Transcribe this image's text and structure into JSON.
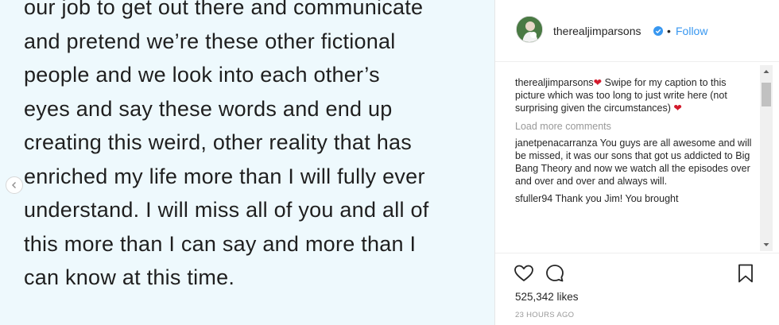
{
  "post": {
    "lines": [
      "our job to get out there and communicate",
      "and pretend we’re these other fictional",
      "people and we look into each other’s",
      "eyes and say these words and end up",
      "creating this weird, other reality that has",
      "enriched my life more than I will fully ever",
      "understand. I will miss all of you and all of",
      "this more than I can say and more than I",
      "can know at this time."
    ],
    "prev_icon": "chevron-left-icon"
  },
  "header": {
    "username": "therealjimparsons",
    "verified_icon": "verified-badge-icon",
    "separator": "•",
    "follow_label": "Follow"
  },
  "caption": {
    "username": "therealjimparsons",
    "text": " Swipe for my caption to this picture which was too long to just write here (not surprising given the circumstances) ",
    "heart": "❤"
  },
  "load_more": "Load more comments",
  "comments": [
    {
      "username": "janetpenacarranza",
      "text": " You guys are all awesome and will be missed, it was our sons that got us addicted to Big Bang Theory and now we watch all the episodes over and over and over and always will."
    },
    {
      "username": "sfuller94",
      "text": " Thank you Jim! You brought"
    }
  ],
  "actions": {
    "like_icon": "heart-icon",
    "comment_icon": "comment-icon",
    "save_icon": "bookmark-icon"
  },
  "likes": "525,342 likes",
  "timestamp": "23 HOURS AGO",
  "colors": {
    "link": "#3897f0",
    "heart": "#d31a2c",
    "verified": "#3897f0",
    "image_bg": "#eef9fd"
  }
}
